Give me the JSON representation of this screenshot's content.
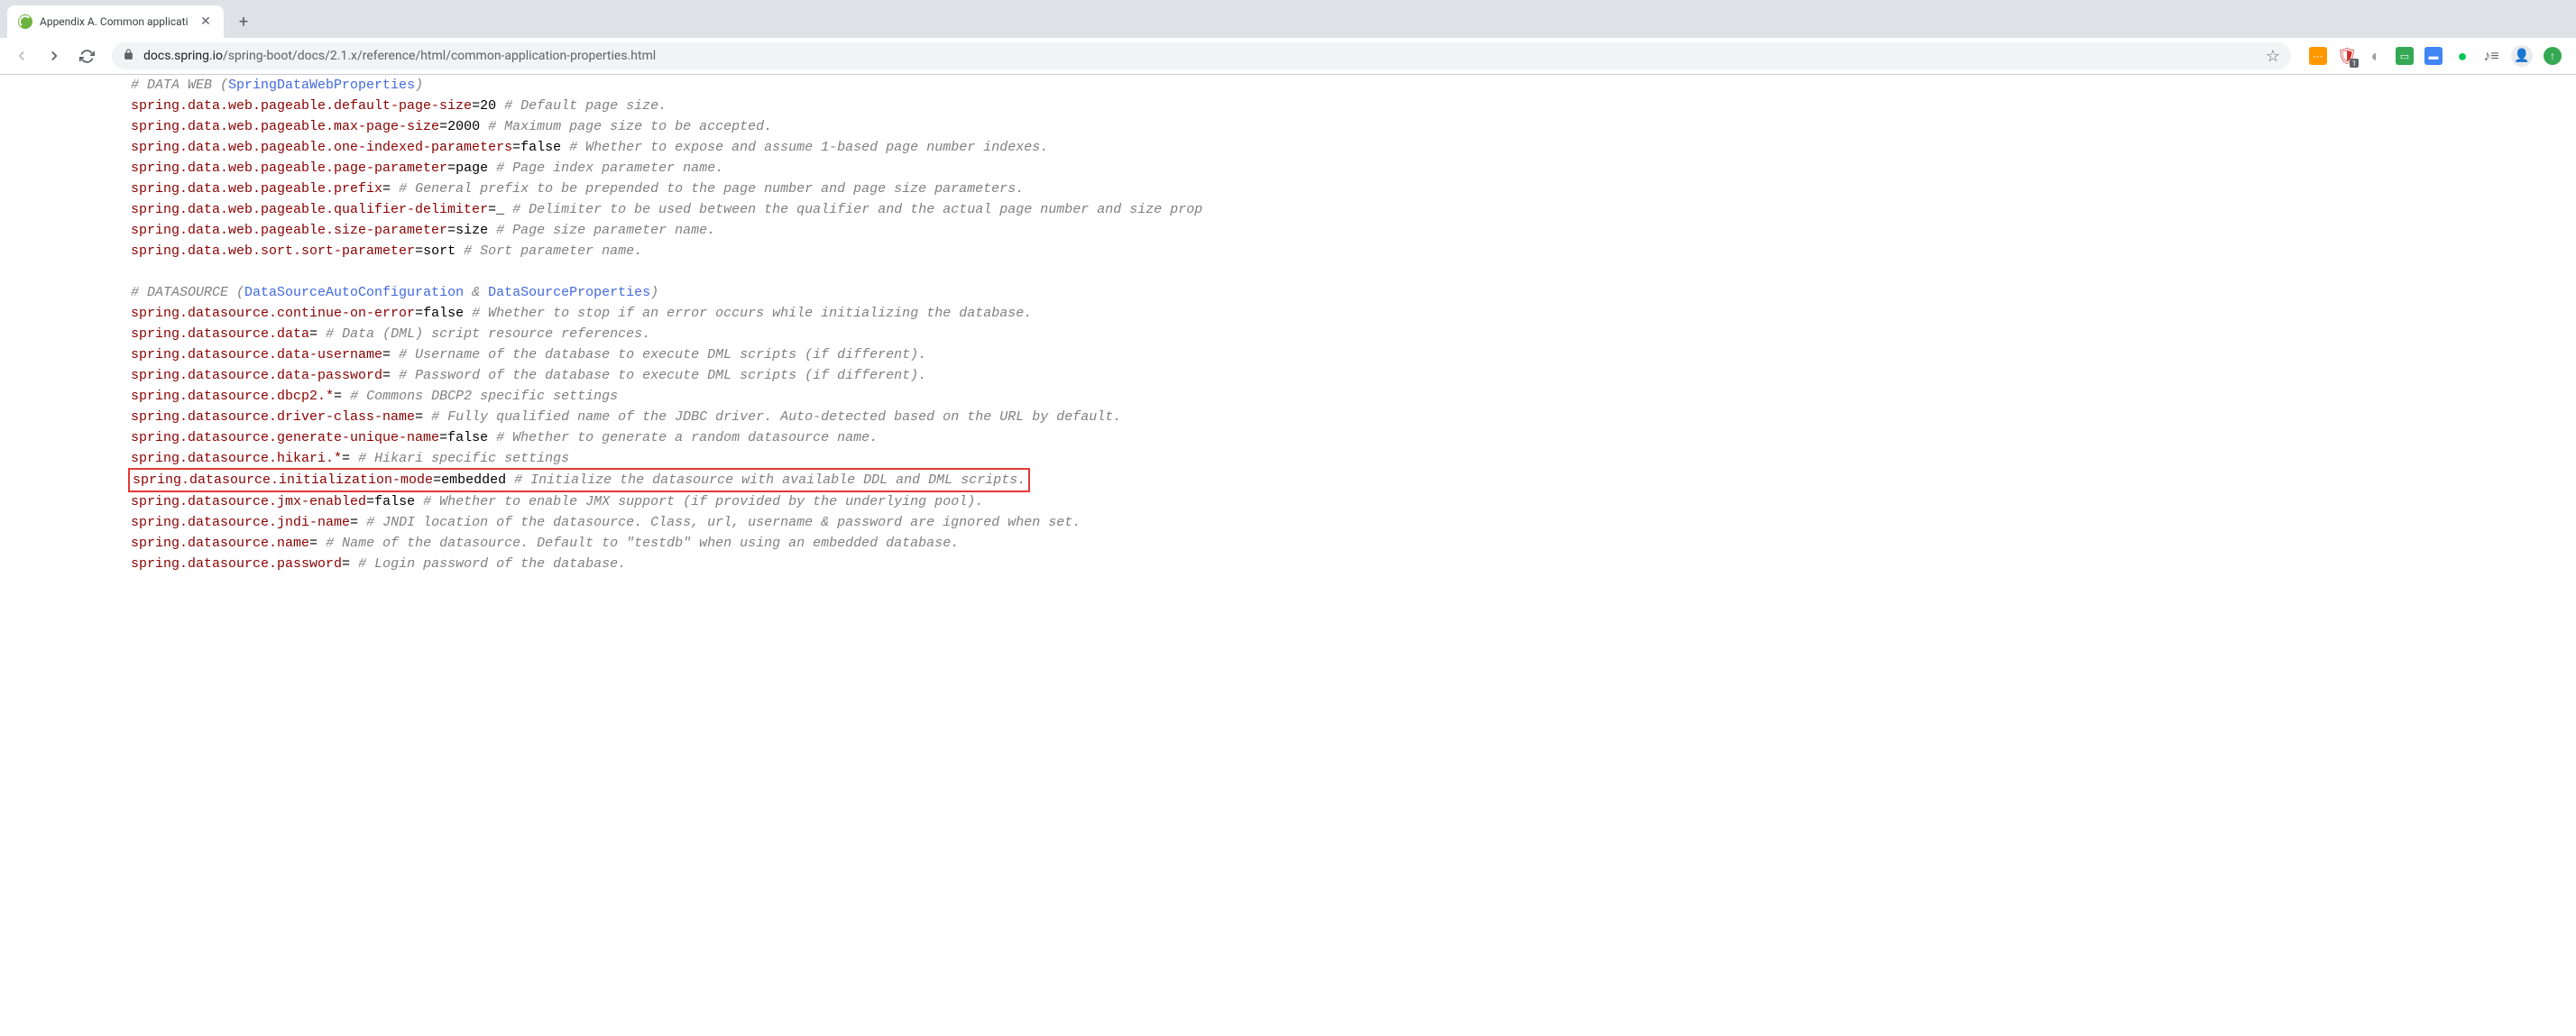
{
  "tab": {
    "title": "Appendix A. Common applicati"
  },
  "url": {
    "host": "docs.spring.io",
    "path": "/spring-boot/docs/2.1.x/reference/html/common-application-properties.html"
  },
  "lines": [
    {
      "type": "section",
      "key": "# DATA WEB (",
      "link": "SpringDataWebProperties",
      "suffix": ")"
    },
    {
      "type": "prop",
      "key": "spring.data.web.pageable.default-page-size",
      "val": "20",
      "comment": "# Default page size."
    },
    {
      "type": "prop",
      "key": "spring.data.web.pageable.max-page-size",
      "val": "2000",
      "comment": "# Maximum page size to be accepted."
    },
    {
      "type": "prop",
      "key": "spring.data.web.pageable.one-indexed-parameters",
      "val": "false",
      "comment": "# Whether to expose and assume 1-based page number indexes."
    },
    {
      "type": "prop",
      "key": "spring.data.web.pageable.page-parameter",
      "val": "page",
      "comment": "# Page index parameter name."
    },
    {
      "type": "prop",
      "key": "spring.data.web.pageable.prefix",
      "val": "",
      "comment": "# General prefix to be prepended to the page number and page size parameters."
    },
    {
      "type": "prop",
      "key": "spring.data.web.pageable.qualifier-delimiter",
      "val": "_",
      "comment": "# Delimiter to be used between the qualifier and the actual page number and size prop"
    },
    {
      "type": "prop",
      "key": "spring.data.web.pageable.size-parameter",
      "val": "size",
      "comment": "# Page size parameter name."
    },
    {
      "type": "prop",
      "key": "spring.data.web.sort.sort-parameter",
      "val": "sort",
      "comment": "# Sort parameter name."
    },
    {
      "type": "blank"
    },
    {
      "type": "section2",
      "prefix": "# DATASOURCE (",
      "link1": "DataSourceAutoConfiguration",
      "amp": " & ",
      "link2": "DataSourceProperties",
      "suffix": ")"
    },
    {
      "type": "prop",
      "key": "spring.datasource.continue-on-error",
      "val": "false",
      "comment": "# Whether to stop if an error occurs while initializing the database."
    },
    {
      "type": "prop",
      "key": "spring.datasource.data",
      "val": "",
      "comment": "# Data (DML) script resource references."
    },
    {
      "type": "prop",
      "key": "spring.datasource.data-username",
      "val": "",
      "comment": "# Username of the database to execute DML scripts (if different)."
    },
    {
      "type": "prop",
      "key": "spring.datasource.data-password",
      "val": "",
      "comment": "# Password of the database to execute DML scripts (if different)."
    },
    {
      "type": "prop",
      "key": "spring.datasource.dbcp2.*",
      "val": "",
      "comment": "# Commons DBCP2 specific settings"
    },
    {
      "type": "prop",
      "key": "spring.datasource.driver-class-name",
      "val": "",
      "comment": "# Fully qualified name of the JDBC driver. Auto-detected based on the URL by default."
    },
    {
      "type": "prop",
      "key": "spring.datasource.generate-unique-name",
      "val": "false",
      "comment": "# Whether to generate a random datasource name."
    },
    {
      "type": "prop",
      "key": "spring.datasource.hikari.*",
      "val": "",
      "comment": "# Hikari specific settings"
    },
    {
      "type": "prop",
      "key": "spring.datasource.initialization-mode",
      "val": "embedded",
      "comment": "# Initialize the datasource with available DDL and DML scripts.",
      "highlighted": true
    },
    {
      "type": "prop",
      "key": "spring.datasource.jmx-enabled",
      "val": "false",
      "comment": "# Whether to enable JMX support (if provided by the underlying pool)."
    },
    {
      "type": "prop",
      "key": "spring.datasource.jndi-name",
      "val": "",
      "comment": "# JNDI location of the datasource. Class, url, username & password are ignored when set."
    },
    {
      "type": "prop",
      "key": "spring.datasource.name",
      "val": "",
      "comment": "# Name of the datasource. Default to \"testdb\" when using an embedded database."
    },
    {
      "type": "prop",
      "key": "spring.datasource.password",
      "val": "",
      "comment": "# Login password of the database."
    }
  ]
}
